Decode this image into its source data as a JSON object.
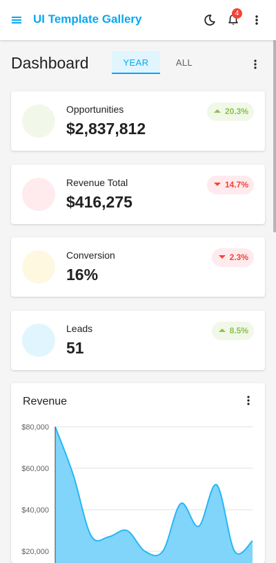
{
  "app": {
    "title": "UI Template Gallery",
    "notification_count": "4"
  },
  "header": {
    "page_title": "Dashboard",
    "tabs": [
      {
        "label": "YEAR",
        "active": true
      },
      {
        "label": "ALL",
        "active": false
      }
    ]
  },
  "cards": [
    {
      "label": "Opportunities",
      "value": "$2,837,812",
      "change": "20.3%",
      "trend": "up",
      "circle_color": "#f1f8e9"
    },
    {
      "label": "Revenue Total",
      "value": "$416,275",
      "change": "14.7%",
      "trend": "down",
      "circle_color": "#ffebee"
    },
    {
      "label": "Conversion",
      "value": "16%",
      "change": "2.3%",
      "trend": "down",
      "circle_color": "#fff8e1"
    },
    {
      "label": "Leads",
      "value": "51",
      "change": "8.5%",
      "trend": "up",
      "circle_color": "#e1f5fe"
    }
  ],
  "colors": {
    "accent": "#03a9f4",
    "up": "#8bc34a",
    "down": "#f44336"
  },
  "chart_data": {
    "type": "area",
    "title": "Revenue",
    "yticks": [
      "$80,000",
      "$60,000",
      "$40,000",
      "$20,000"
    ],
    "ytick_values": [
      80000,
      60000,
      40000,
      20000
    ],
    "ylim": [
      0,
      80000
    ],
    "series": [
      {
        "values": [
          80000,
          57000,
          27500,
          27000,
          30000,
          20000,
          20000,
          43000,
          32000,
          52000,
          20000,
          25000
        ]
      }
    ],
    "colors": {
      "line": "#29b6f6",
      "fill": "#81d4fa",
      "grid": "#e0e0e0"
    }
  }
}
